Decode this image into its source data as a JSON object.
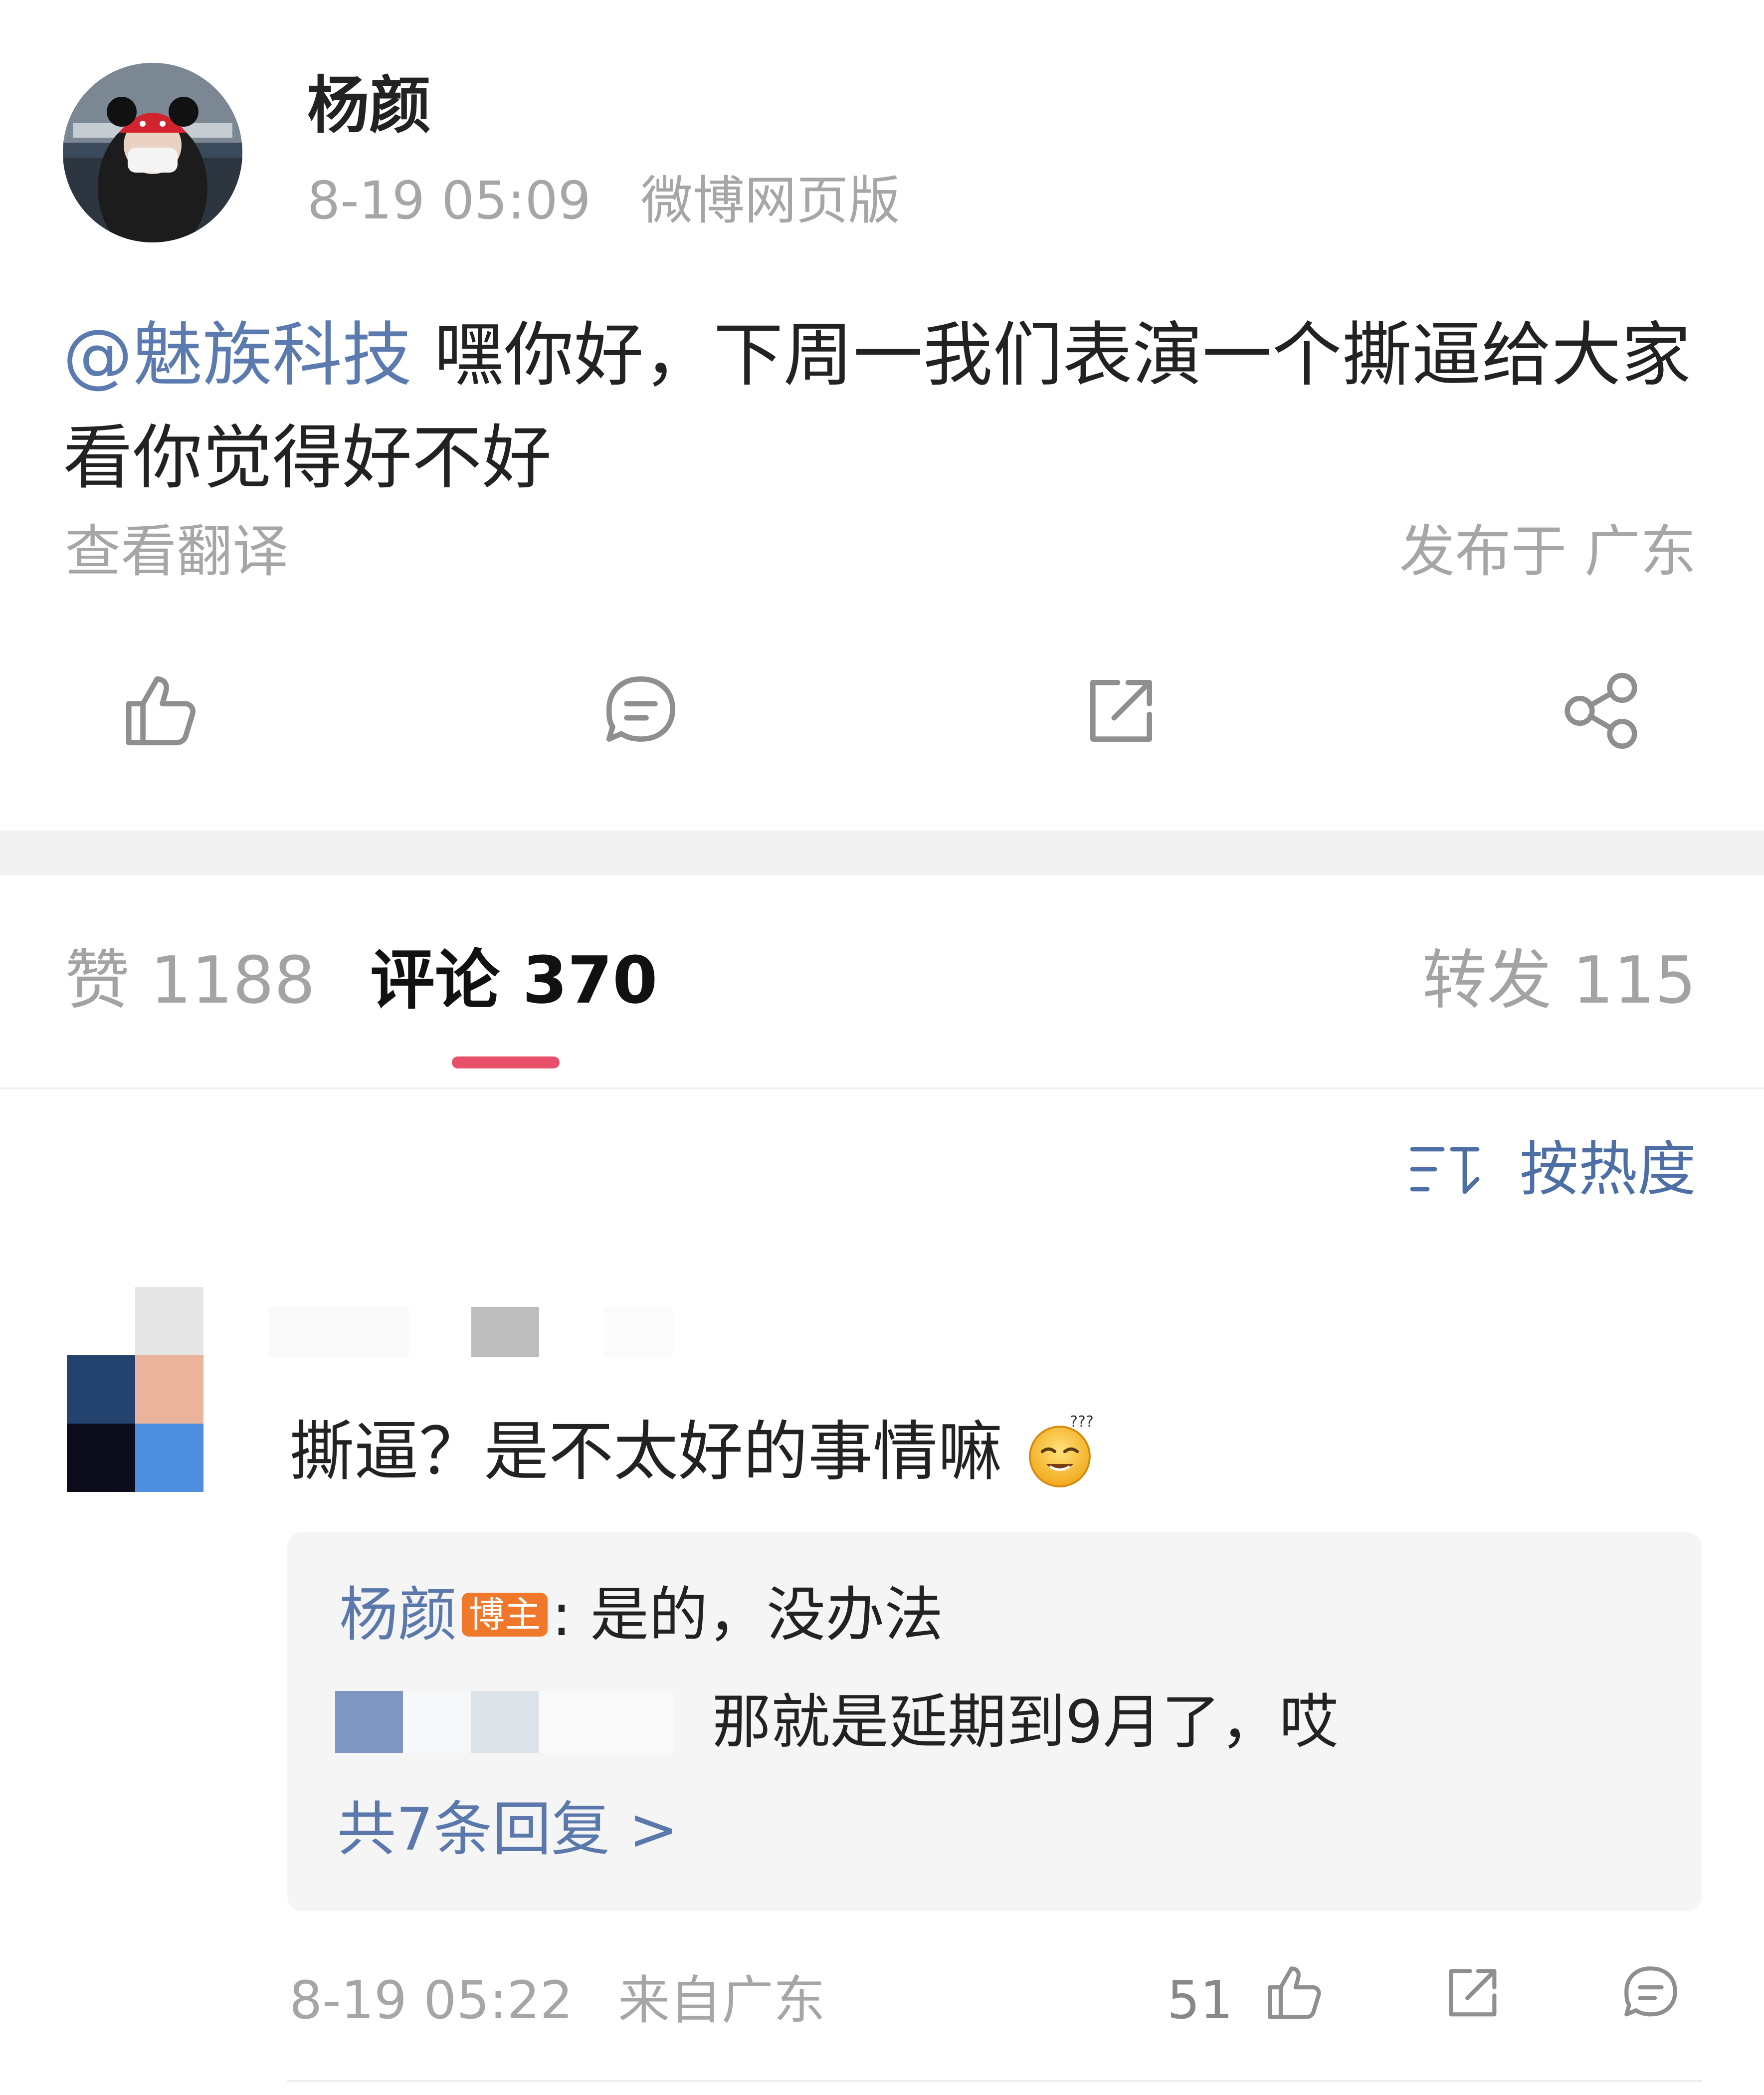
{
  "post": {
    "author": "杨颜",
    "time": "8-19 05:09",
    "source": "微博网页版",
    "mention": "@魅族科技",
    "text": " 嘿你好，下周一我们表演一个撕逼给大家看你觉得好不好",
    "translate": "查看翻译",
    "location": "发布于 广东"
  },
  "actions": {
    "icons": [
      "thumbs-up-icon",
      "comment-icon",
      "repost-icon",
      "share-icon"
    ]
  },
  "tabs": {
    "likes": "赞 1188",
    "comments": "评论 370",
    "reposts": "转发 115"
  },
  "sort": {
    "label": "按热度",
    "icon": "sort-icon"
  },
  "comment": {
    "text": "撕逼？是不太好的事情嘛",
    "emoji": "dizzy-smile-emoji",
    "reply": {
      "author": "杨颜",
      "badge": "博主",
      "text": ": 是的，没办法",
      "second_text": "那就是延期到9月了，哎",
      "more": "共7条回复 >"
    },
    "time": "8-19 05:22",
    "location": "来自广东",
    "likes": "51"
  },
  "colors": {
    "accent_underline": "#e8506a",
    "link_blue": "#5a78ac",
    "badge_orange": "#f0782a"
  }
}
